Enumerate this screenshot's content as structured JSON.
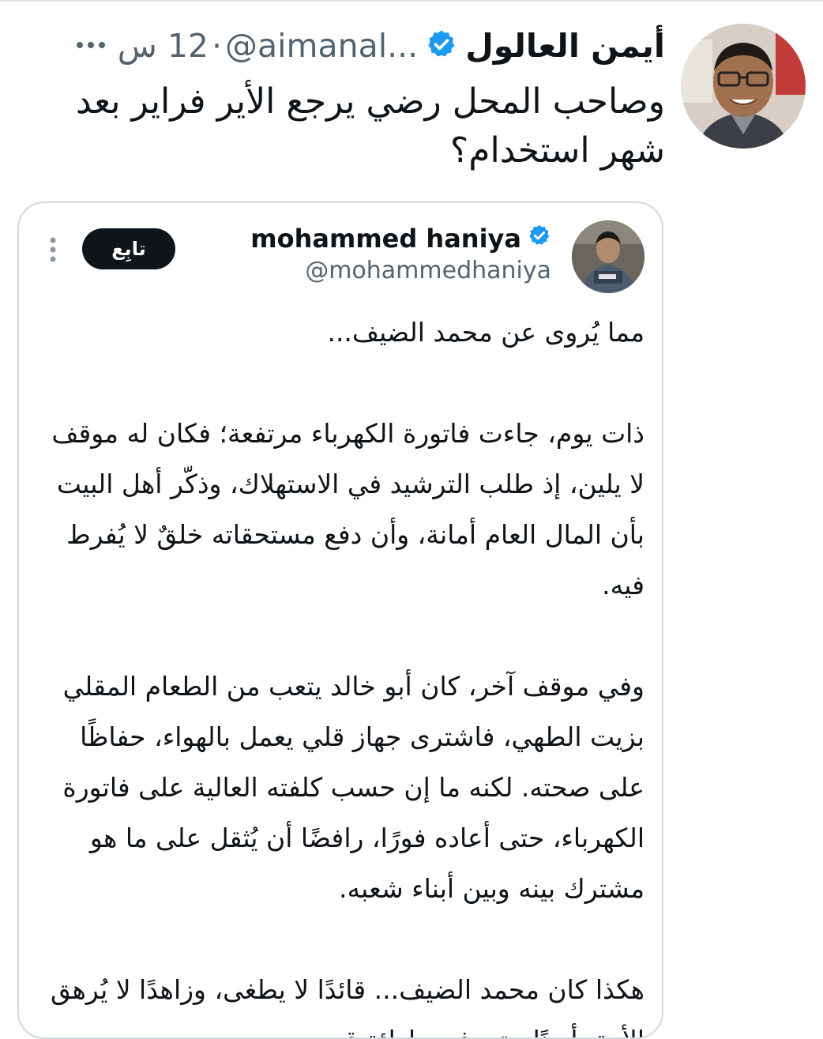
{
  "main_tweet": {
    "author_name": "أيمن العالول",
    "handle": "@aimanal...",
    "separator": "·",
    "time": "12 س",
    "lines": [
      "وصاحب المحل رضي يرجع الأير فراير بعد",
      "شهر استخدام؟"
    ]
  },
  "quoted_tweet": {
    "author_name": "mohammed haniya",
    "handle": "@mohammedhaniya",
    "follow_label": "تابِع",
    "paragraphs": [
      "مما يُروى عن محمد الضيف...",
      "ذات يوم، جاءت فاتورة الكهرباء مرتفعة؛ فكان له موقف لا يلين، إذ طلب الترشيد في الاستهلاك، وذكّر أهل البيت بأن المال العام أمانة، وأن دفع مستحقاته خلقٌ لا يُفرط فيه.",
      "وفي موقف آخر، كان أبو خالد يتعب من الطعام المقلي بزيت الطهي، فاشترى جهاز قلي يعمل بالهواء، حفاظًا على صحته. لكنه ما إن حسب كلفته العالية على فاتورة الكهرباء، حتى أعاده فورًا، رافضًا أن يُثقل على ما هو مشترك بينه وبين أبناء شعبه.",
      "هكذا كان محمد الضيف... قائدًا لا يطغى، وزاهدًا لا يُرهق الأمة، أمينًا حتى في واطئة قدمه."
    ]
  },
  "icons": {
    "verified": "verified-badge-icon",
    "more": "more-options-icon"
  },
  "colors": {
    "verified_blue": "#1d9bf0",
    "secondary_text": "#536471",
    "card_border": "#cfd9de",
    "follow_button_bg": "#0f1419"
  }
}
